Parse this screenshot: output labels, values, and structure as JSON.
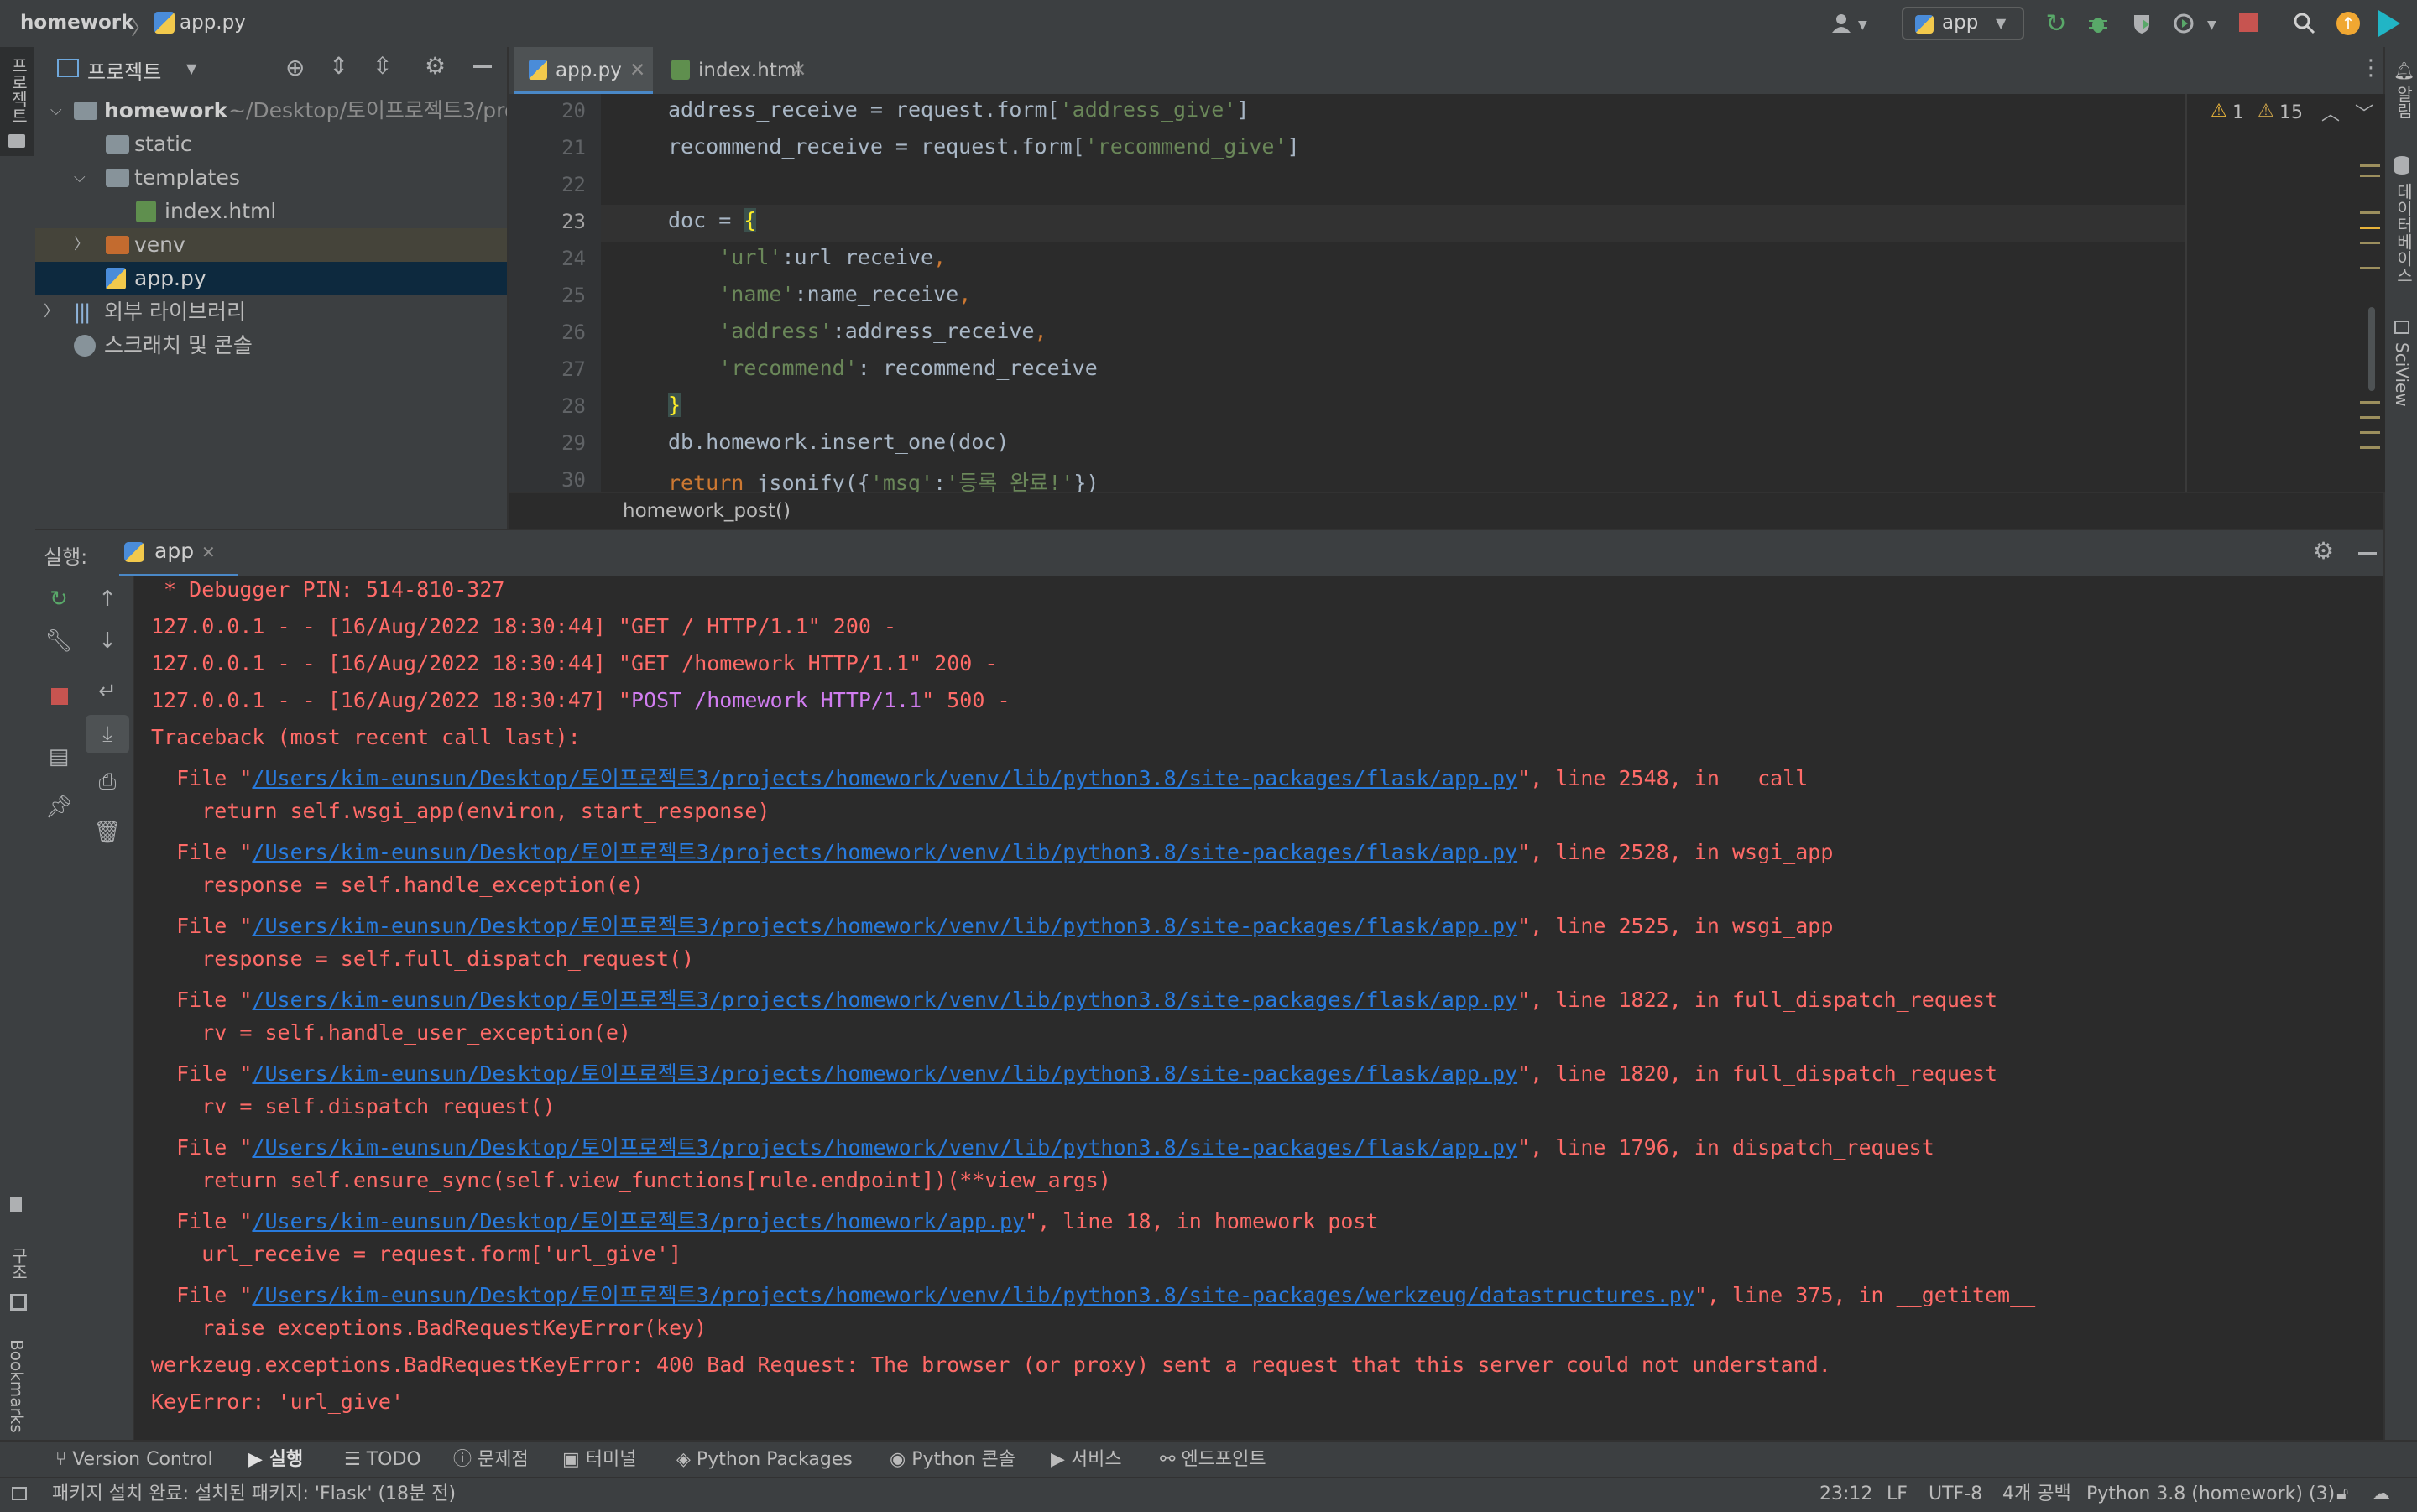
{
  "titlebar": {
    "project": "homework",
    "file": "app.py",
    "run_config": "app"
  },
  "left_stripe": {
    "project_label": "프로젝트",
    "structure_label": "구조",
    "bookmarks_label": "Bookmarks"
  },
  "right_stripe": {
    "notifications_label": "알림",
    "database_label": "데이터베이스",
    "sciview_label": "SciView"
  },
  "project_panel": {
    "title": "프로젝트",
    "tree": [
      {
        "label": "homework",
        "extra": "~/Desktop/토이프로젝트3/pro"
      },
      {
        "label": "static"
      },
      {
        "label": "templates"
      },
      {
        "label": "index.html"
      },
      {
        "label": "venv"
      },
      {
        "label": "app.py"
      },
      {
        "label": "외부 라이브러리"
      },
      {
        "label": "스크래치 및 콘솔"
      }
    ]
  },
  "editor": {
    "tabs": [
      {
        "label": "app.py"
      },
      {
        "label": "index.html"
      }
    ],
    "warnings": {
      "errors": "1",
      "warnings": "15"
    },
    "breadcrumb": "homework_post()",
    "line_numbers": [
      "20",
      "21",
      "22",
      "23",
      "24",
      "25",
      "26",
      "27",
      "28",
      "29",
      "30"
    ]
  },
  "run_panel": {
    "label": "실행:",
    "tab": "app"
  },
  "console": [
    " * Debugger PIN: 514-810-327",
    "127.0.0.1 - - [16/Aug/2022 18:30:44] \"GET / HTTP/1.1\" 200 -",
    "127.0.0.1 - - [16/Aug/2022 18:30:44] \"GET /homework HTTP/1.1\" 200 -",
    {
      "pre": "127.0.0.1 - - [16/Aug/2022 18:30:47] \"",
      "post": "POST /homework HTTP/1.1",
      "suf": "\" 500 -"
    },
    "Traceback (most recent call last):",
    {
      "pre": "  File \"",
      "link": "/Users/kim-eunsun/Desktop/토이프로젝트3/projects/homework/venv/lib/python3.8/site-packages/flask/app.py",
      "suf": "\", line 2548, in __call__"
    },
    "    return self.wsgi_app(environ, start_response)",
    {
      "pre": "  File \"",
      "link": "/Users/kim-eunsun/Desktop/토이프로젝트3/projects/homework/venv/lib/python3.8/site-packages/flask/app.py",
      "suf": "\", line 2528, in wsgi_app"
    },
    "    response = self.handle_exception(e)",
    {
      "pre": "  File \"",
      "link": "/Users/kim-eunsun/Desktop/토이프로젝트3/projects/homework/venv/lib/python3.8/site-packages/flask/app.py",
      "suf": "\", line 2525, in wsgi_app"
    },
    "    response = self.full_dispatch_request()",
    {
      "pre": "  File \"",
      "link": "/Users/kim-eunsun/Desktop/토이프로젝트3/projects/homework/venv/lib/python3.8/site-packages/flask/app.py",
      "suf": "\", line 1822, in full_dispatch_request"
    },
    "    rv = self.handle_user_exception(e)",
    {
      "pre": "  File \"",
      "link": "/Users/kim-eunsun/Desktop/토이프로젝트3/projects/homework/venv/lib/python3.8/site-packages/flask/app.py",
      "suf": "\", line 1820, in full_dispatch_request"
    },
    "    rv = self.dispatch_request()",
    {
      "pre": "  File \"",
      "link": "/Users/kim-eunsun/Desktop/토이프로젝트3/projects/homework/venv/lib/python3.8/site-packages/flask/app.py",
      "suf": "\", line 1796, in dispatch_request"
    },
    "    return self.ensure_sync(self.view_functions[rule.endpoint])(**view_args)",
    {
      "pre": "  File \"",
      "link": "/Users/kim-eunsun/Desktop/토이프로젝트3/projects/homework/app.py",
      "suf": "\", line 18, in homework_post"
    },
    "    url_receive = request.form['url_give']",
    {
      "pre": "  File \"",
      "link": "/Users/kim-eunsun/Desktop/토이프로젝트3/projects/homework/venv/lib/python3.8/site-packages/werkzeug/datastructures.py",
      "suf": "\", line 375, in __getitem__"
    },
    "    raise exceptions.BadRequestKeyError(key)",
    "werkzeug.exceptions.BadRequestKeyError: 400 Bad Request: The browser (or proxy) sent a request that this server could not understand.",
    "KeyError: 'url_give'"
  ],
  "bottom_tools": [
    {
      "label": "Version Control",
      "icon": "branch-icon"
    },
    {
      "label": "실행",
      "icon": "play-icon"
    },
    {
      "label": "TODO",
      "icon": "list-icon"
    },
    {
      "label": "문제점",
      "icon": "info-icon"
    },
    {
      "label": "터미널",
      "icon": "terminal-icon"
    },
    {
      "label": "Python Packages",
      "icon": "layers-icon"
    },
    {
      "label": "Python 콘솔",
      "icon": "python-icon"
    },
    {
      "label": "서비스",
      "icon": "services-icon"
    },
    {
      "label": "엔드포인트",
      "icon": "endpoints-icon"
    }
  ],
  "status": {
    "message": "패키지 설치 완료: 설치된 패키지: 'Flask' (18분 전)",
    "position": "23:12",
    "line_sep": "LF",
    "encoding": "UTF-8",
    "indent": "4개 공백",
    "interpreter": "Python 3.8 (homework) (3)"
  },
  "colors": {
    "error": "#ff6b68",
    "link": "#287bde",
    "string": "#6a8759",
    "keyword": "#cc7832",
    "post": "#d17df0"
  }
}
